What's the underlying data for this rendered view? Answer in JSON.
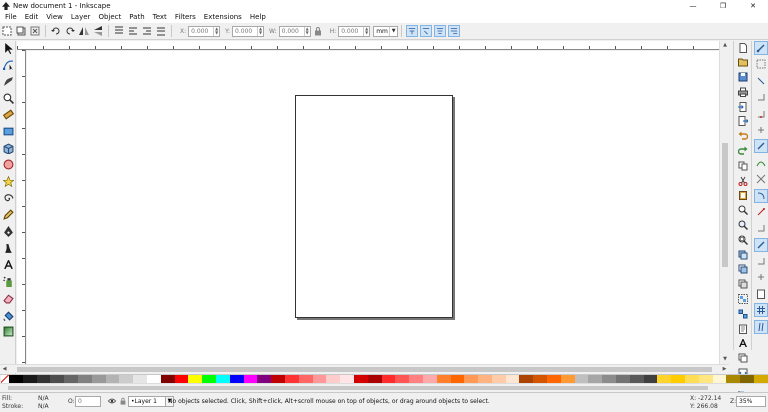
{
  "window": {
    "title": "New document 1 - Inkscape",
    "controls": {
      "minimize": "—",
      "maximize": "❐",
      "close": "✕"
    }
  },
  "menu": [
    {
      "label": "File"
    },
    {
      "label": "Edit"
    },
    {
      "label": "View"
    },
    {
      "label": "Layer"
    },
    {
      "label": "Object"
    },
    {
      "label": "Path"
    },
    {
      "label": "Text"
    },
    {
      "label": "Filters"
    },
    {
      "label": "Extensions"
    },
    {
      "label": "Help"
    }
  ],
  "toolbar": {
    "x_label": "X:",
    "x_value": "0.000",
    "y_label": "Y:",
    "y_value": "0.000",
    "w_label": "W:",
    "w_value": "0.000",
    "h_label": "H:",
    "h_value": "0.000",
    "unit": "mm",
    "lock_icon": "lock-icon"
  },
  "palette": {
    "colors": [
      "#000000",
      "#1a1a1a",
      "#333333",
      "#4d4d4d",
      "#666666",
      "#808080",
      "#999999",
      "#b3b3b3",
      "#cccccc",
      "#e6e6e6",
      "#ffffff",
      "#800000",
      "#ff0000",
      "#ffff00",
      "#00ff00",
      "#00ffff",
      "#0000ff",
      "#ff00ff",
      "#800080",
      "#c00000",
      "#ff3333",
      "#ff6666",
      "#ff9999",
      "#ffcccc",
      "#ffe5e5",
      "#d40000",
      "#aa0000",
      "#ff2a2a",
      "#ff5555",
      "#ff8080",
      "#ffaaaa",
      "#ff7f2a",
      "#ff6600",
      "#ff9955",
      "#ffb380",
      "#ffccaa",
      "#ffe6d5",
      "#aa4400",
      "#d45500",
      "#ff6600",
      "#ff9933",
      "#bfbfbf",
      "#a6a6a6",
      "#8c8c8c",
      "#737373",
      "#595959",
      "#404040",
      "#ffd42a",
      "#ffcc00",
      "#ffdd55",
      "#ffe680",
      "#fff6d5",
      "#aa8800",
      "#806600",
      "#d4aa00"
    ]
  },
  "status": {
    "fill_label": "Fill:",
    "fill_value": "N/A",
    "stroke_label": "Stroke:",
    "stroke_value": "N/A",
    "opacity_label": "O:",
    "opacity_value": "0",
    "layer": "•Layer 1",
    "message": "No objects selected. Click, Shift+click, Alt+scroll mouse on top of objects, or drag around objects to select.",
    "x_coord": "X: -272.14",
    "y_coord": "Y: 266.08",
    "zoom_label": "Z:",
    "zoom": "35%"
  }
}
